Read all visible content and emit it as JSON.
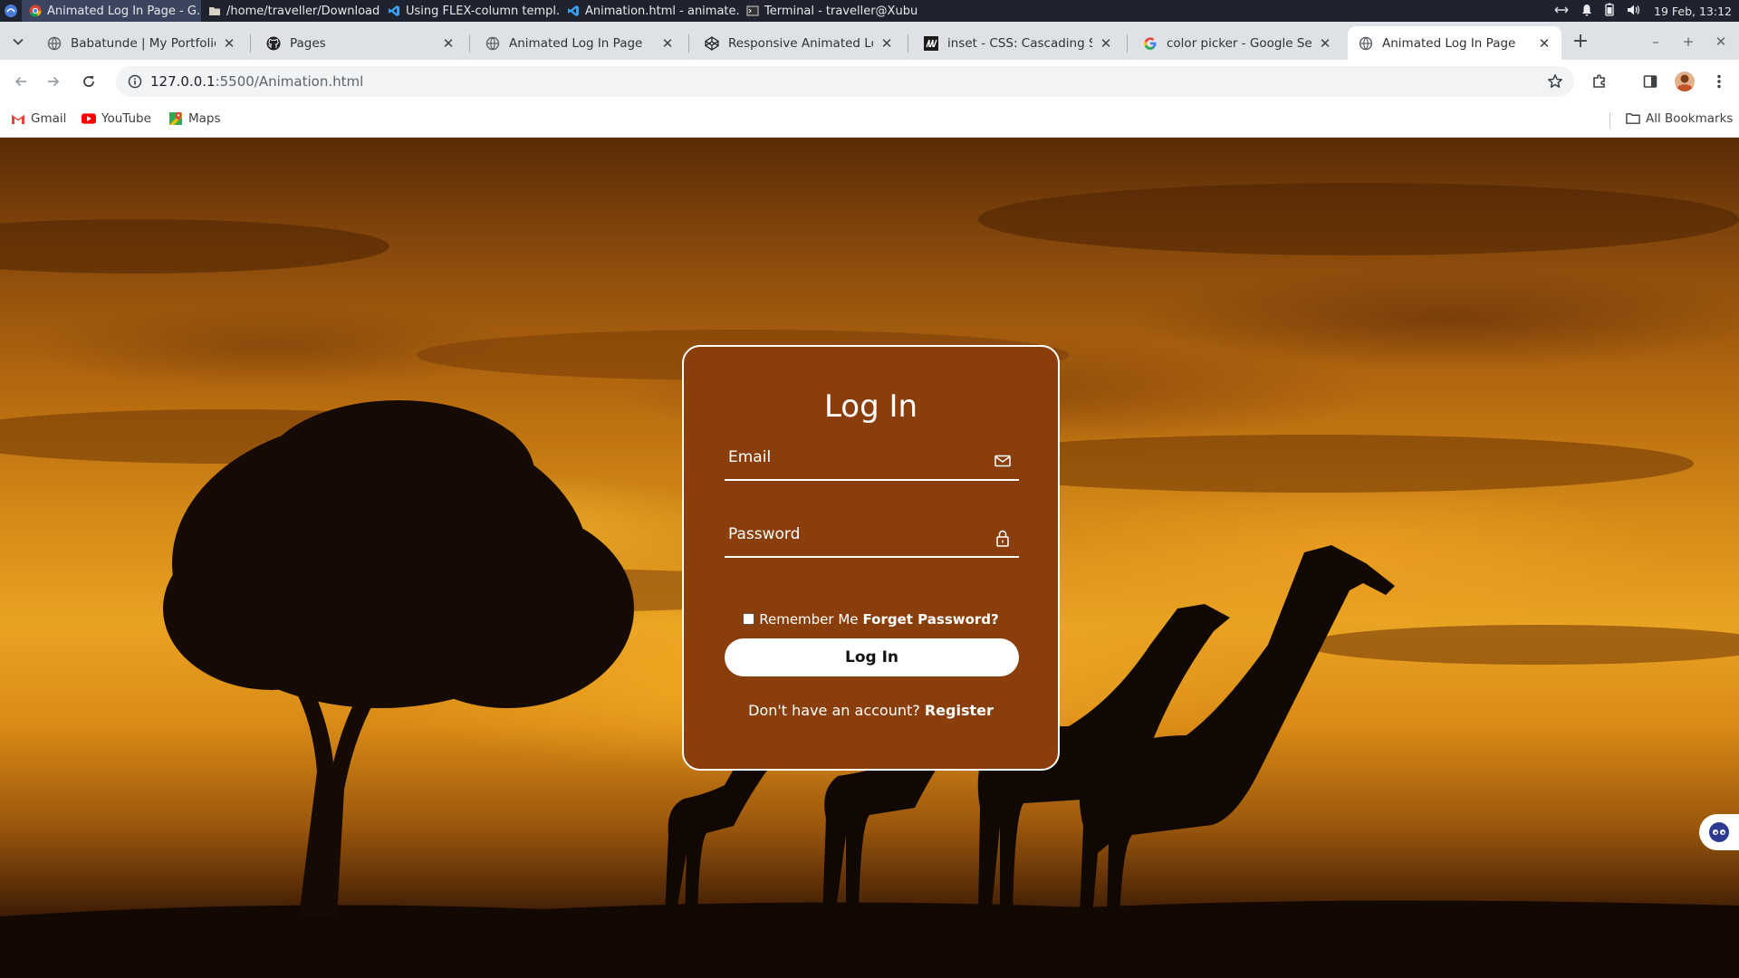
{
  "os_panel": {
    "tasks": [
      {
        "label": "Animated Log In Page - G...",
        "icon": "chrome-icon",
        "active": true
      },
      {
        "label": "/home/traveller/Downloads",
        "icon": "folder-icon",
        "active": false
      },
      {
        "label": "Using FLEX-column templ...",
        "icon": "vscode-icon",
        "active": false
      },
      {
        "label": "Animation.html - animate...",
        "icon": "vscode-icon",
        "active": false
      },
      {
        "label": "Terminal - traveller@Xubu...",
        "icon": "terminal-icon",
        "active": false
      }
    ],
    "clock": "19 Feb, 13:12"
  },
  "browser": {
    "tabs": [
      {
        "title": "Babatunde | My Portfolio",
        "icon": "globe-icon"
      },
      {
        "title": "Pages",
        "icon": "github-icon"
      },
      {
        "title": "Animated Log In Page",
        "icon": "globe-icon"
      },
      {
        "title": "Responsive Animated Log In",
        "icon": "codepen-icon"
      },
      {
        "title": "inset - CSS: Cascading Style",
        "icon": "mdn-icon"
      },
      {
        "title": "color picker - Google Search",
        "icon": "google-icon"
      },
      {
        "title": "Animated Log In Page",
        "icon": "globe-icon",
        "active": true
      }
    ],
    "url_host": "127.0.0.1",
    "url_path": ":5500/Animation.html",
    "bookmarks": [
      {
        "label": "Gmail",
        "icon": "gmail-icon"
      },
      {
        "label": "YouTube",
        "icon": "youtube-icon"
      },
      {
        "label": "Maps",
        "icon": "maps-icon"
      }
    ],
    "all_bookmarks": "All Bookmarks"
  },
  "login": {
    "title": "Log In",
    "email_label": "Email",
    "password_label": "Password",
    "remember_label": "Remember Me",
    "forgot_label": "Forget Password?",
    "button_label": "Log In",
    "register_prompt": "Don't have an account?",
    "register_label": "Register",
    "card_color": "#8a3e0b"
  }
}
